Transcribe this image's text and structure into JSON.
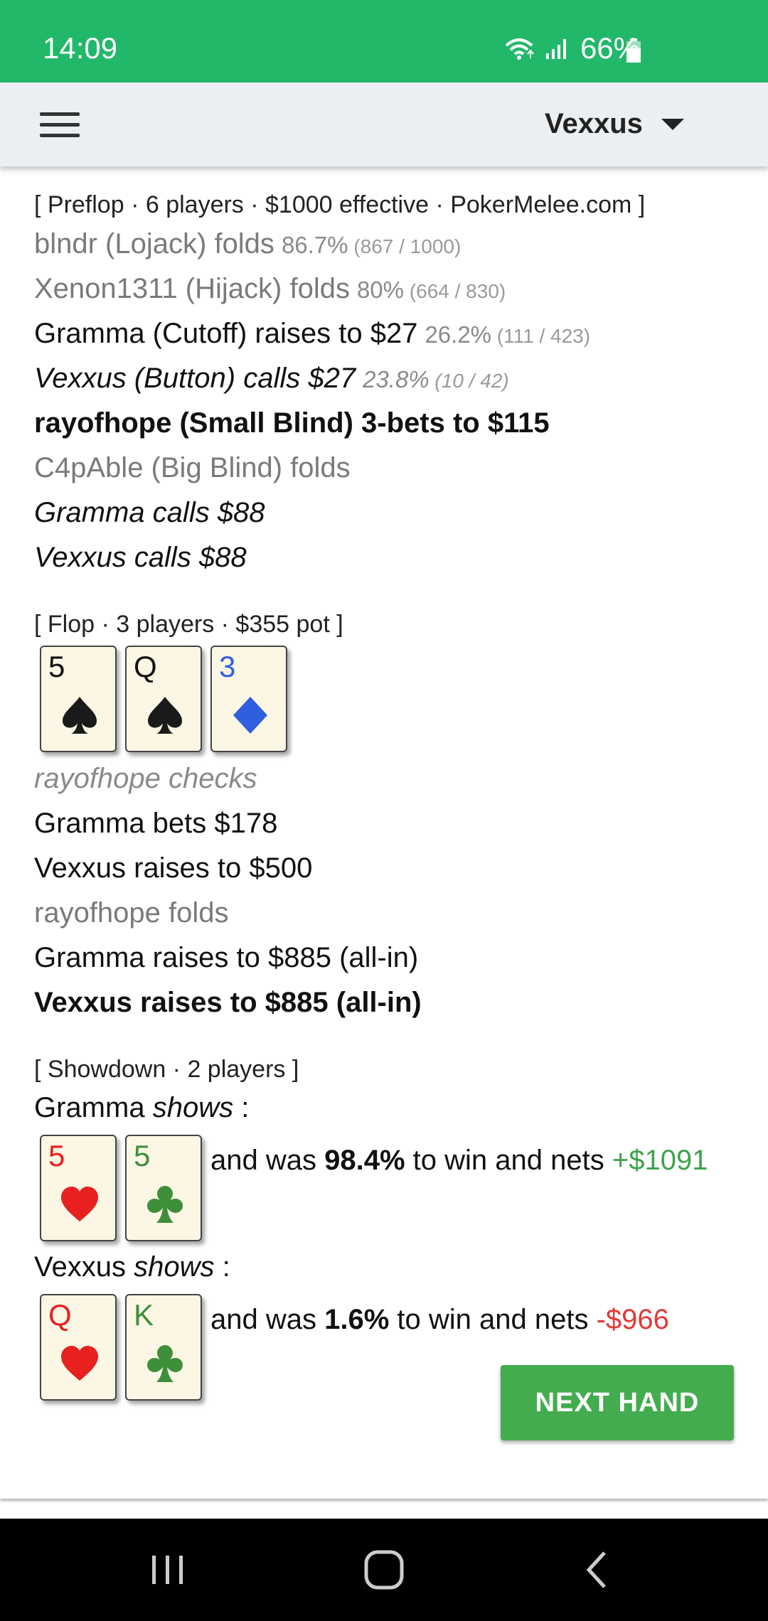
{
  "status_bar": {
    "time": "14:09",
    "battery": "66%"
  },
  "app_bar": {
    "user": "Vexxus"
  },
  "colors": {
    "status_bar": "#21b86a",
    "app_bar": "#eceff1",
    "button": "#43ac4e",
    "win": "#3fa34d",
    "loss": "#e53935",
    "diamond": "#2f5fe0",
    "club": "#3f8f3a",
    "heart": "#e82020",
    "spade": "#1a1a1a"
  },
  "preflop": {
    "header": "[ Preflop · 6 players · $1000 effective · PokerMelee.com ]",
    "actions": [
      {
        "text": "blndr (Lojack) folds",
        "pct": "86.7%",
        "frac": "(867 / 1000)",
        "style": "fold"
      },
      {
        "text": "Xenon1311 (Hijack) folds",
        "pct": "80%",
        "frac": "(664 / 830)",
        "style": "fold"
      },
      {
        "text": "Gramma (Cutoff) raises to $27",
        "pct": "26.2%",
        "frac": "(111 / 423)",
        "style": "normal"
      },
      {
        "text": "Vexxus (Button) calls $27",
        "pct": "23.8%",
        "frac": "(10 / 42)",
        "style": "call"
      },
      {
        "text": "rayofhope (Small Blind) 3-bets to $115",
        "style": "bold"
      },
      {
        "text": "C4pAble (Big Blind) folds",
        "style": "fold"
      },
      {
        "text": "Gramma calls $88",
        "style": "call"
      },
      {
        "text": "Vexxus calls $88",
        "style": "call"
      }
    ]
  },
  "flop": {
    "header": "[ Flop · 3 players · $355 pot ]",
    "board": [
      {
        "rank": "5",
        "suit": "spade"
      },
      {
        "rank": "Q",
        "suit": "spade"
      },
      {
        "rank": "3",
        "suit": "diamond"
      }
    ],
    "actions": [
      {
        "text": "rayofhope checks",
        "style": "check"
      },
      {
        "text": "Gramma bets $178",
        "style": "normal"
      },
      {
        "text": "Vexxus raises to $500",
        "style": "normal"
      },
      {
        "text": "rayofhope folds",
        "style": "fold"
      },
      {
        "text": "Gramma raises to $885 (all-in)",
        "style": "normal"
      },
      {
        "text": "Vexxus raises to $885 (all-in)",
        "style": "bold"
      }
    ]
  },
  "showdown": {
    "header": "[ Showdown · 2 players ]",
    "players": [
      {
        "name": "Gramma",
        "shows": "shows",
        "colon": ":",
        "cards": [
          {
            "rank": "5",
            "suit": "heart"
          },
          {
            "rank": "5",
            "suit": "club"
          }
        ],
        "pre": "and was",
        "equity": "98.4%",
        "mid": "to win and nets",
        "net": "+$1091",
        "result": "pos"
      },
      {
        "name": "Vexxus",
        "shows": "shows",
        "colon": ":",
        "cards": [
          {
            "rank": "Q",
            "suit": "heart"
          },
          {
            "rank": "K",
            "suit": "club"
          }
        ],
        "pre": "and was",
        "equity": "1.6%",
        "mid": "to win and nets",
        "net": "-$966",
        "result": "neg"
      }
    ]
  },
  "next_hand_button": "NEXT HAND"
}
